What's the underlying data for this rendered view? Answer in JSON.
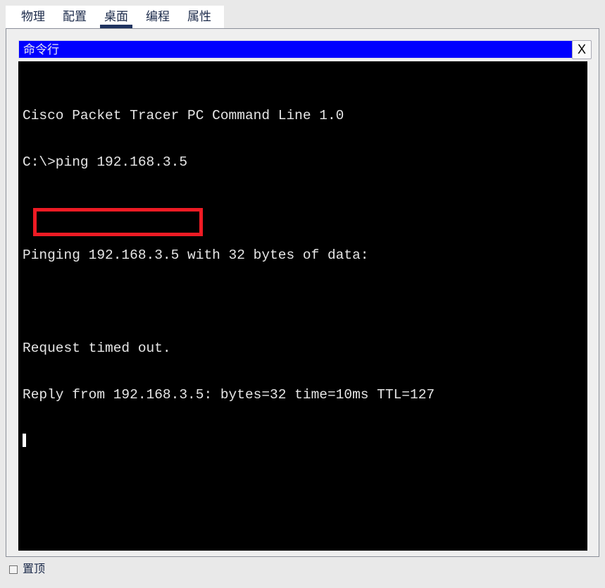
{
  "window": {
    "tabs": [
      {
        "label": "物理",
        "active": false
      },
      {
        "label": "配置",
        "active": false
      },
      {
        "label": "桌面",
        "active": true
      },
      {
        "label": "编程",
        "active": false
      },
      {
        "label": "属性",
        "active": false
      }
    ]
  },
  "dialog": {
    "title": "命令行",
    "close_label": "X",
    "title_bar_color": "#0000ff"
  },
  "terminal": {
    "background": "#000000",
    "text_color": "#e6e6e6",
    "lines": [
      "Cisco Packet Tracer PC Command Line 1.0",
      "C:\\>ping 192.168.3.5",
      "",
      "Pinging 192.168.3.5 with 32 bytes of data:",
      "",
      "Request timed out.",
      "Reply from 192.168.3.5: bytes=32 time=10ms TTL=127"
    ],
    "cursor_line_index": 7
  },
  "annotation": {
    "type": "rectangle",
    "color": "#ef1b24",
    "target_text": "Request timed out."
  },
  "footer": {
    "always_on_top_label": "置顶",
    "always_on_top_checked": false
  }
}
